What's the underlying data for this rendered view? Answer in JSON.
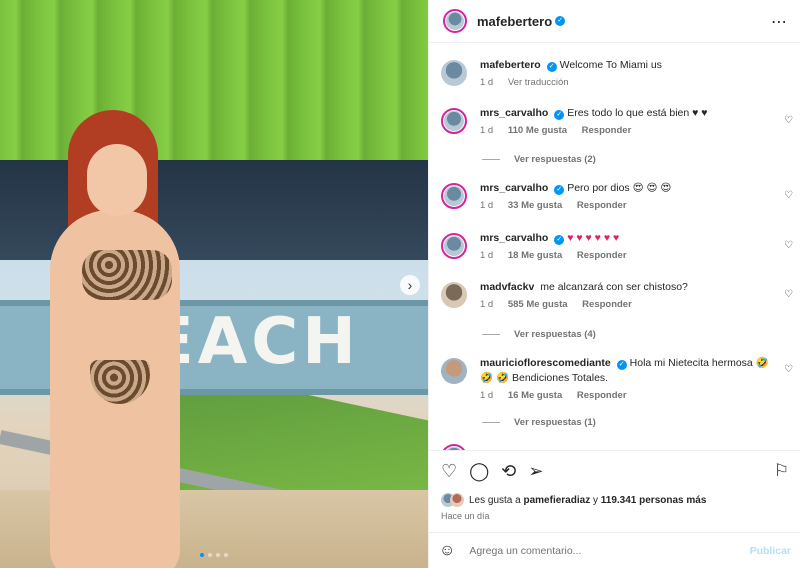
{
  "post": {
    "author": "mafebertero",
    "more_icon": "⋯"
  },
  "comments": [
    {
      "user": "mafebertero",
      "text": "Welcome To Miami us",
      "time": "1 d",
      "likes": "",
      "action": "Ver traducción",
      "replies": ""
    },
    {
      "user": "mrs_carvalho",
      "text": "Eres todo lo que está bien ♥ ♥",
      "time": "1 d",
      "likes": "110 Me gusta",
      "action": "Responder",
      "replies": "Ver respuestas (2)"
    },
    {
      "user": "mrs_carvalho",
      "text": "Pero por dios 😍 😍 😍",
      "time": "1 d",
      "likes": "33 Me gusta",
      "action": "Responder",
      "replies": ""
    },
    {
      "user": "mrs_carvalho",
      "text": "♥ ♥ ♥ ♥ ♥ ♥",
      "time": "1 d",
      "likes": "18 Me gusta",
      "action": "Responder",
      "replies": ""
    },
    {
      "user": "madvfackv",
      "text": "me alcanzará con ser chistoso?",
      "time": "1 d",
      "likes": "585 Me gusta",
      "action": "Responder",
      "replies": "Ver respuestas (4)"
    },
    {
      "user": "mauriciofloresc​omediante",
      "text": "Hola mi Nietecita hermosa 🤣",
      "text2": "🤣 🤣 Bendiciones Totales.",
      "time": "1 d",
      "likes": "16 Me gusta",
      "action": "Responder",
      "replies": "Ver respuestas (1)"
    }
  ],
  "actions": {
    "likes_prefix": "Les gusta a",
    "liker": "pamefieradiaz",
    "likes_mid": "y",
    "likes_count": "119.341 personas más",
    "posted": "Hace un día"
  },
  "compose": {
    "placeholder": "Agrega un comentario...",
    "publish": "Publicar"
  },
  "photo": {
    "sign_text": "EACH",
    "next_icon": "›"
  }
}
